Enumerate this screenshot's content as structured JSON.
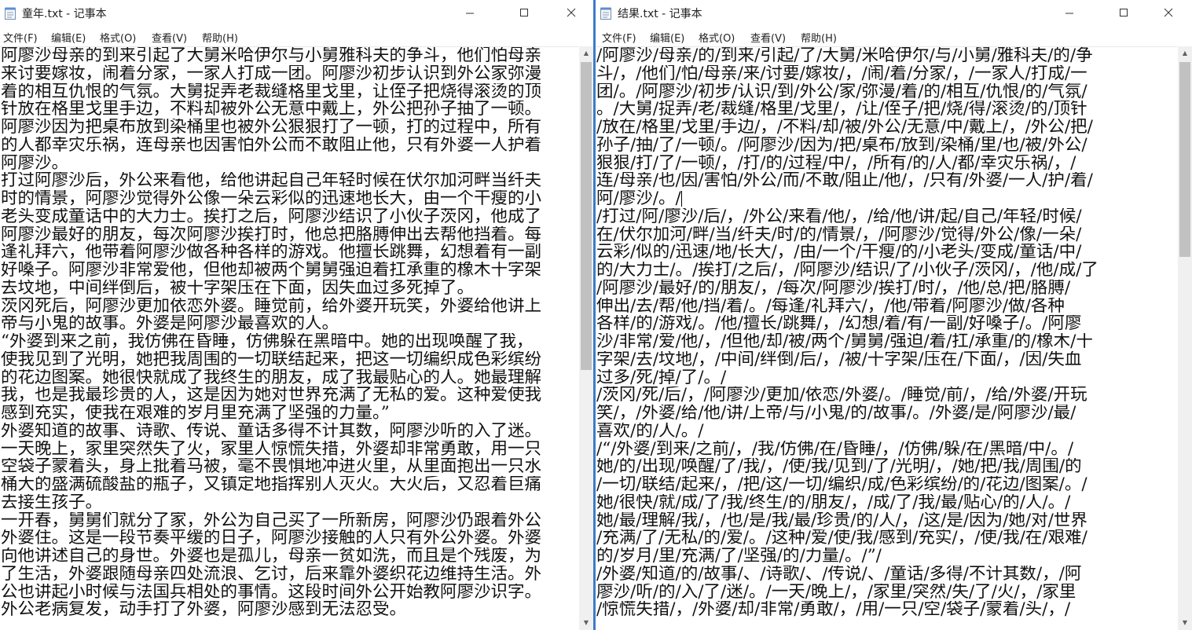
{
  "left_window": {
    "title": "童年.txt - 记事本",
    "menu": [
      "文件(F)",
      "编辑(E)",
      "格式(O)",
      "查看(V)",
      "帮助(H)"
    ],
    "lines": [
      "阿廖沙母亲的到来引起了大舅米哈伊尔与小舅雅科夫的争斗，他们怕母亲",
      "来讨要嫁妆，闹着分家，一家人打成一团。阿廖沙初步认识到外公家弥漫",
      "着的相互仇恨的气氛。大舅捉弄老裁缝格里戈里，让侄子把烧得滚烫的顶",
      "针放在格里戈里手边，不料却被外公无意中戴上，外公把孙子抽了一顿。",
      "阿廖沙因为把桌布放到染桶里也被外公狠狠打了一顿，打的过程中，所有",
      "的人都幸灾乐祸，连母亲也因害怕外公而不敢阻止他，只有外婆一人护着",
      "阿廖沙。",
      "打过阿廖沙后，外公来看他，给他讲起自己年轻时候在伏尔加河畔当纤夫",
      "时的情景，阿廖沙觉得外公像一朵云彩似的迅速地长大，由一个干瘦的小",
      "老头变成童话中的大力士。挨打之后，阿廖沙结识了小伙子茨冈，他成了",
      "阿廖沙最好的朋友，每次阿廖沙挨打时，他总把胳膊伸出去帮他挡着。每",
      "逢礼拜六，他带着阿廖沙做各种各样的游戏。他擅长跳舞，幻想着有一副",
      "好嗓子。阿廖沙非常爱他，但他却被两个舅舅强迫着扛承重的橡木十字架",
      "去坟地，中间绊倒后，被十字架压在下面，因失血过多死掉了。",
      "茨冈死后，阿廖沙更加依恋外婆。睡觉前，给外婆开玩笑，外婆给他讲上",
      "帝与小鬼的故事。外婆是阿廖沙最喜欢的人。",
      "“外婆到来之前，我仿佛在昏睡，仿佛躲在黑暗中。她的出现唤醒了我，",
      "使我见到了光明，她把我周围的一切联结起来，把这一切编织成色彩缤纷",
      "的花边图案。她很快就成了我终生的朋友，成了我最贴心的人。她最理解",
      "我，也是我最珍贵的人，这是因为她对世界充满了无私的爱。这种爱使我",
      "感到充实，使我在艰难的岁月里充满了坚强的力量。”",
      "外婆知道的故事、诗歌、传说、童话多得不计其数，阿廖沙听的入了迷。",
      "一天晚上，家里突然失了火，家里人惊慌失措，外婆却非常勇敢，用一只",
      "空袋子蒙着头，身上批着马被，毫不畏惧地冲进火里，从里面抱出一只水",
      "桶大的盛满硫酸盐的瓶子，又镇定地指挥别人灭火。大火后，又忍着巨痛",
      "去接生孩子。",
      "一开春，舅舅们就分了家，外公为自己买了一所新房，阿廖沙仍跟着外公",
      "外婆住。这是一段节奏平缓的日子，阿廖沙接触的人只有外公外婆。外婆",
      "向他讲述自己的身世。外婆也是孤儿，母亲一贫如洗，而且是个残废，为",
      "了生活，外婆跟随母亲四处流浪、乞讨，后来靠外婆织花边维持生活。外",
      "公也讲起小时候与法国兵相处的事情。这段时间外公开始教阿廖沙识字。",
      "外公老病复发，动手打了外婆，阿廖沙感到无法忍受。"
    ]
  },
  "right_window": {
    "title": "结果.txt - 记事本",
    "menu": [
      "文件(F)",
      "编辑(E)",
      "格式(O)",
      "查看(V)",
      "帮助(H)"
    ],
    "lines": [
      "/阿廖沙/母亲/的/到来/引起/了/大舅/米哈伊尔/与/小舅/雅科夫/的/争",
      "斗/，/他们/怕/母亲/来/讨要/嫁妆/，/闹/着/分家/，/一家人/打成/一",
      "团/。/阿廖沙/初步/认识/到/外公/家/弥漫/着/的/相互/仇恨/的/气氛/",
      "。/大舅/捉弄/老/裁缝/格里/戈里/，/让/侄子/把/烧/得/滚烫/的/顶针",
      "/放在/格里/戈里/手边/，/不料/却/被/外公/无意/中/戴上/，/外公/把/",
      "孙子/抽/了/一顿/。/阿廖沙/因为/把/桌布/放到/染桶/里/也/被/外公/",
      "狠狠/打/了/一顿/，/打/的/过程/中/，/所有/的/人/都/幸灾乐祸/，/",
      "连/母亲/也/因/害怕/外公/而/不敢/阻止/他/，/只有/外婆/一人/护/着/",
      "阿/廖沙/。/",
      "/打过/阿/廖沙/后/，/外公/来看/他/，/给/他/讲/起/自己/年轻/时候/",
      "在/伏尔加河/畔/当/纤夫/时/的/情景/，/阿廖沙/觉得/外公/像/一朵/",
      "云彩/似的/迅速/地/长大/，/由/一个/干瘦/的/小老头/变成/童话/中/",
      "的/大力士/。/挨打/之后/，/阿廖沙/结识/了/小伙子/茨冈/，/他/成/了",
      "/阿廖沙/最好/的/朋友/，/每次/阿廖沙/挨打/时/，/他/总/把/胳膊/",
      "伸出/去/帮/他/挡/着/。/每逢/礼拜六/，/他/带着/阿廖沙/做/各种",
      "各样/的/游戏/。/他/擅长/跳舞/，/幻想/着/有/一副/好嗓子/。/阿廖",
      "沙/非常/爱/他/，/但他/却/被/两个/舅舅/强迫/着/扛/承重/的/橡木/十",
      "字架/去/坟地/，/中间/绊倒/后/，/被/十字架/压在/下面/，/因/失血",
      "过多/死/掉/了/。/",
      "/茨冈/死/后/，/阿廖沙/更加/依恋/外婆/。/睡觉/前/，/给/外婆/开玩",
      "笑/，/外婆/给/他/讲/上帝/与/小鬼/的/故事/。/外婆/是/阿廖沙/最/",
      "喜欢/的/人/。/",
      "/“/外婆/到来/之前/，/我/仿佛/在/昏睡/，/仿佛/躲/在/黑暗/中/。/",
      "她/的/出现/唤醒/了/我/，/使/我/见到/了/光明/，/她/把/我/周围/的",
      "/一切/联结/起来/，/把/这/一切/编织/成/色彩缤纷/的/花边/图案/。/",
      "她/很快/就/成/了/我/终生/的/朋友/，/成/了/我/最/贴心/的/人/。/",
      "她/最/理解/我/，/也/是/我/最/珍贵/的/人/，/这/是/因为/她/对/世界",
      "/充满/了/无私/的/爱/。/这种/爱/使/我/感到/充实/，/使/我/在/艰难/",
      "的/岁月/里/充满/了/坚强/的/力量/。/”/",
      "/外婆/知道/的/故事/、/诗歌/、/传说/、/童话/多得/不计其数/，/阿",
      "廖沙/听/的/入/了/迷/。/一天/晚上/，/家里/突然/失/了/火/，/家里",
      "/惊慌失措/，/外婆/却/非常/勇敢/，/用/一只/空/袋子/蒙着/头/，/"
    ]
  }
}
